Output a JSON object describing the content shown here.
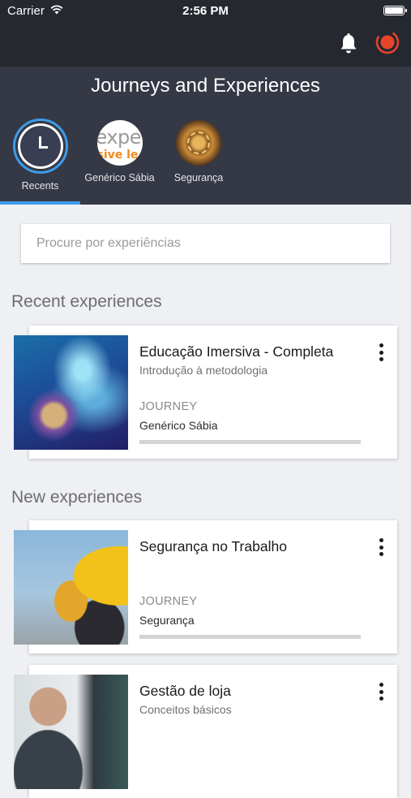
{
  "status_bar": {
    "carrier": "Carrier",
    "time": "2:56 PM"
  },
  "header": {
    "title": "Journeys and Experiences",
    "categories": [
      {
        "label": "Recents",
        "icon": "clock-icon",
        "selected": true
      },
      {
        "label": "Genérico Sábia",
        "image_text_1": "expe",
        "image_text_2": "sive le"
      },
      {
        "label": "Segurança",
        "icon": "gear-compass-image"
      }
    ]
  },
  "search": {
    "placeholder": "Procure por experiências"
  },
  "recent": {
    "title": "Recent experiences",
    "items": [
      {
        "title": "Educação Imersiva - Completa",
        "subtitle": "Introdução à metodologia",
        "type": "JOURNEY",
        "author": "Genérico Sábia",
        "progress": 0
      }
    ]
  },
  "new": {
    "title": "New experiences",
    "items": [
      {
        "title": "Segurança no Trabalho",
        "subtitle": "",
        "type": "JOURNEY",
        "author": "Segurança",
        "progress": 0
      },
      {
        "title": "Gestão de loja",
        "subtitle": "Conceitos básicos"
      }
    ]
  },
  "colors": {
    "accent": "#3d9be9",
    "header_bg": "#353845",
    "status_bg": "#262830",
    "record": "#e8452a"
  }
}
